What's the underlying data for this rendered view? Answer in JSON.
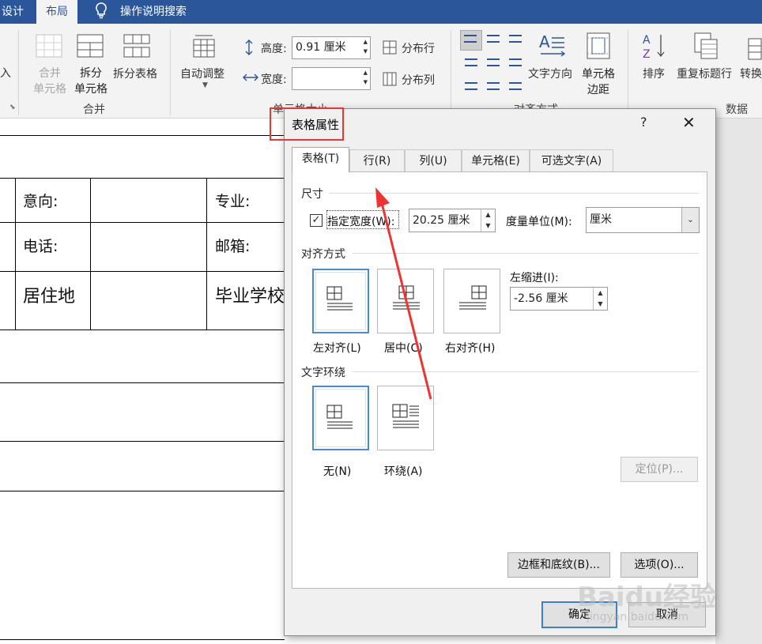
{
  "ribbon": {
    "tabs": [
      "设计",
      "布局"
    ],
    "tell_me": "操作说明搜索",
    "left_cut_label": "入",
    "merge_cells": [
      "合并",
      "单元格"
    ],
    "split_cells": [
      "拆分",
      "单元格"
    ],
    "split_table": "拆分表格",
    "merge_group": "合并",
    "autofit": "自动调整",
    "height_label": "高度:",
    "height_value": "0.91 厘米",
    "width_label": "宽度:",
    "width_value": "",
    "distribute_rows": "分布行",
    "distribute_cols": "分布列",
    "cell_size_group": "单元格大小",
    "text_direction": "文字方向",
    "cell_margins": [
      "单元格",
      "边距"
    ],
    "alignment_group": "对齐方式",
    "sort": "排序",
    "repeat_header": "重复标题行",
    "convert": "转换",
    "data_group": "数据"
  },
  "document": {
    "cells": [
      "意向:",
      "专业:",
      "电话:",
      "邮箱:",
      "居住地",
      "毕业学校"
    ]
  },
  "dialog": {
    "title": "表格属性",
    "help": "?",
    "tabs": [
      "表格(T)",
      "行(R)",
      "列(U)",
      "单元格(E)",
      "可选文字(A)"
    ],
    "size_section": "尺寸",
    "preferred_width_checked": true,
    "preferred_width_label": "指定宽度(W):",
    "preferred_width_value": "20.25 厘米",
    "measure_in_label": "度量单位(M):",
    "measure_in_value": "厘米",
    "alignment_section": "对齐方式",
    "align_left": "左对齐(L)",
    "align_center": "居中(C)",
    "align_right": "右对齐(H)",
    "indent_label": "左缩进(I):",
    "indent_value": "-2.56 厘米",
    "wrap_section": "文字环绕",
    "wrap_none": "无(N)",
    "wrap_around": "环绕(A)",
    "positioning_button": "定位(P)...",
    "borders_button": "边框和底纹(B)...",
    "options_button": "选项(O)...",
    "ok_button": "确定",
    "cancel_button": "取消"
  },
  "watermark": {
    "brand": "Baidu经验",
    "url": "jingyan.baidu.com"
  },
  "colors": {
    "ribbon_blue": "#2b579a",
    "annotation_red": "#ee3333",
    "selected_blue": "#4a8ad6"
  }
}
